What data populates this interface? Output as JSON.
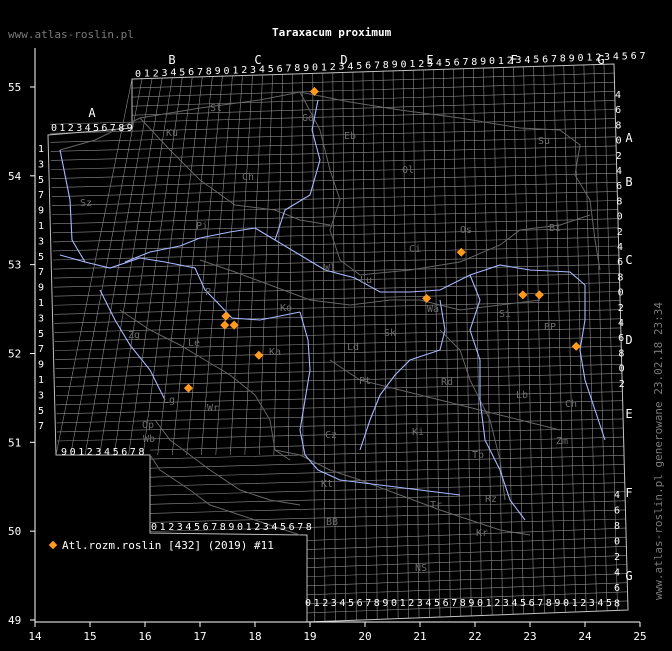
{
  "site_label": "www.atlas-roslin.pl",
  "title": "Taraxacum proximum",
  "generated_label": "www.atlas-roslin.pl generowane 23.02.18 23:34",
  "legend": {
    "label": "Atl.rozm.roslin [432] (2019) #11",
    "color": "#ff9a1f"
  },
  "axes": {
    "x_ticks": [
      "14",
      "15",
      "16",
      "17",
      "18",
      "19",
      "20",
      "21",
      "22",
      "23",
      "24",
      "25"
    ],
    "y_ticks": [
      "55",
      "54",
      "53",
      "52",
      "51",
      "50",
      "49"
    ]
  },
  "grid": {
    "letters_top": [
      "B",
      "C",
      "D",
      "E",
      "F",
      "G"
    ],
    "letter_a": "A",
    "digits_top": "0123456789",
    "digits_a": "0123456789",
    "digits_bottom_left": "9012345678",
    "digits_bottom_mid": "0123456789012345678",
    "digits_bottom_main": "012345678901234567890123456789012345",
    "letters_left_col": [
      "1",
      "3",
      "5",
      "7",
      "9",
      "1",
      "3",
      "5",
      "7",
      "9",
      "1",
      "3",
      "5",
      "7",
      "9",
      "1",
      "3",
      "5",
      "7"
    ],
    "right_col_upper": [
      "4",
      "6",
      "8",
      "0",
      "2",
      "4",
      "6",
      "8",
      "0",
      "2",
      "4",
      "6",
      "8",
      "0",
      "2",
      "4",
      "6",
      "8",
      "0",
      "2"
    ],
    "right_letters": [
      "A",
      "B",
      "C",
      "D",
      "E",
      "F",
      "G"
    ],
    "right_col_lower": [
      "4",
      "6",
      "8",
      "0",
      "2",
      "4",
      "6",
      "8"
    ]
  },
  "regions": [
    "Sl",
    "Ku",
    "Gd",
    "Eb",
    "Su",
    "Ch",
    "Ol",
    "Pi",
    "Bi",
    "Ci",
    "Sz",
    "Os",
    "Wl",
    "Lu",
    "Wa",
    "P",
    "Ko",
    "Si",
    "BP",
    "Zg",
    "Le",
    "Ka",
    "Sk",
    "Ld",
    "Pt",
    "Rd",
    "Lb",
    "Lg",
    "Wr",
    "Ch",
    "Op",
    "Wb",
    "Cz",
    "Ki",
    "Zm",
    "Tb",
    "Kt",
    "Tr",
    "Rz",
    "BB",
    "NS",
    "Kr"
  ],
  "observations": [
    {
      "lon": 19.08,
      "lat": 54.95
    },
    {
      "lon": 21.75,
      "lat": 53.14
    },
    {
      "lon": 21.12,
      "lat": 52.62
    },
    {
      "lon": 22.87,
      "lat": 52.66
    },
    {
      "lon": 23.17,
      "lat": 52.66
    },
    {
      "lon": 17.47,
      "lat": 52.42
    },
    {
      "lon": 17.45,
      "lat": 52.32
    },
    {
      "lon": 17.62,
      "lat": 52.32
    },
    {
      "lon": 18.07,
      "lat": 51.98
    },
    {
      "lon": 23.84,
      "lat": 52.08
    },
    {
      "lon": 16.79,
      "lat": 51.61
    }
  ]
}
